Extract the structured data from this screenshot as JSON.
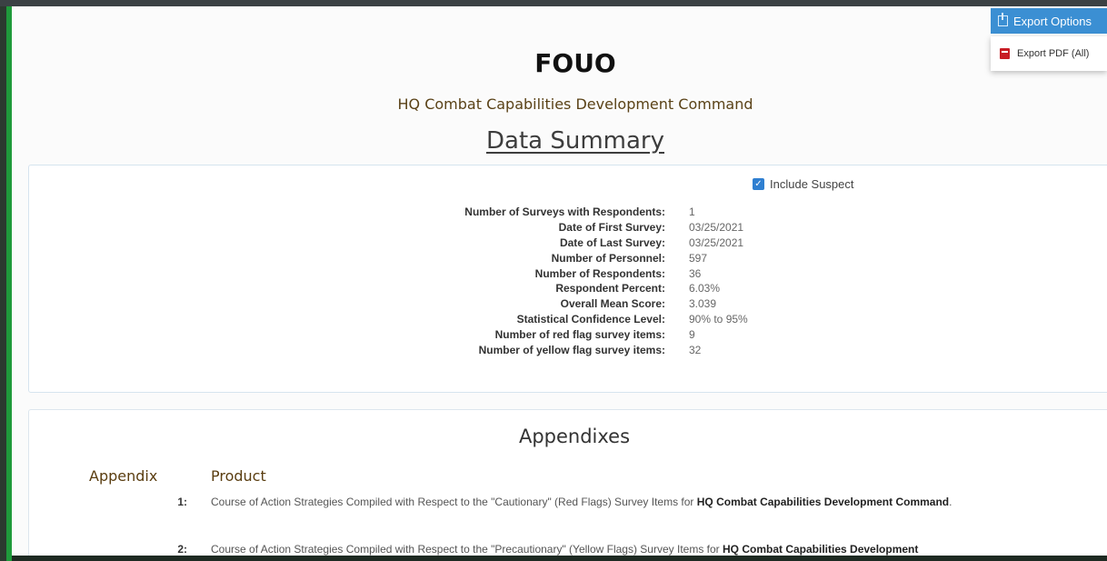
{
  "export": {
    "button_label": "Export Options",
    "menu_item_label": "Export PDF (All)"
  },
  "header": {
    "classification": "FOUO",
    "organization": "HQ Combat Capabilities Development Command",
    "title": "Data Summary"
  },
  "summary": {
    "include_suspect_label": "Include Suspect",
    "include_suspect_checked": true,
    "rows": [
      {
        "label": "Number of Surveys with Respondents:",
        "value": "1"
      },
      {
        "label": "Date of First Survey:",
        "value": "03/25/2021"
      },
      {
        "label": "Date of Last Survey:",
        "value": "03/25/2021"
      },
      {
        "label": "Number of Personnel:",
        "value": "597"
      },
      {
        "label": "Number of Respondents:",
        "value": "36"
      },
      {
        "label": "Respondent Percent:",
        "value": "6.03%"
      },
      {
        "label": "Overall Mean Score:",
        "value": "3.039"
      },
      {
        "label": "Statistical Confidence Level:",
        "value": "90% to 95%"
      },
      {
        "label": "Number of red flag survey items:",
        "value": "9"
      },
      {
        "label": "Number of yellow flag survey items:",
        "value": "32"
      }
    ]
  },
  "appendixes": {
    "title": "Appendixes",
    "col_appendix": "Appendix",
    "col_product": "Product",
    "items": [
      {
        "number": "1:",
        "text_before": "Course of Action Strategies Compiled with Respect to the \"Cautionary\" (Red Flags) Survey Items for ",
        "org_bold": "HQ Combat Capabilities Development Command",
        "text_after": "."
      },
      {
        "number": "2:",
        "text_before": "Course of Action Strategies Compiled with Respect to the \"Precautionary\" (Yellow Flags) Survey Items for ",
        "org_bold": "HQ Combat Capabilities Development",
        "text_after": ""
      }
    ]
  },
  "colors": {
    "accent_blue": "#3b8fd3",
    "left_bar_green": "#1f9a3b",
    "org_text_brown": "#5a4217",
    "pdf_red": "#c81d25"
  }
}
